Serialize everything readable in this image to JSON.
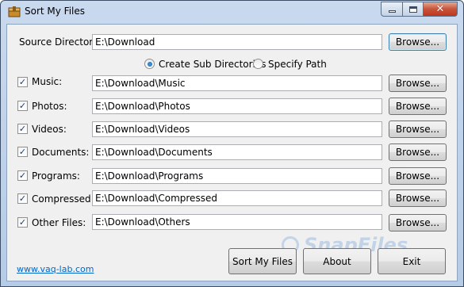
{
  "window": {
    "title": "Sort My Files"
  },
  "source": {
    "label": "Source Directory:",
    "value": "E:\\Download",
    "browse_label": "Browse..."
  },
  "mode": {
    "options": [
      {
        "label": "Create Sub Directories",
        "selected": true
      },
      {
        "label": "Specify Path",
        "selected": false
      }
    ]
  },
  "categories": [
    {
      "label": "Music:",
      "checked": true,
      "path": "E:\\Download\\Music",
      "browse_label": "Browse..."
    },
    {
      "label": "Photos:",
      "checked": true,
      "path": "E:\\Download\\Photos",
      "browse_label": "Browse..."
    },
    {
      "label": "Videos:",
      "checked": true,
      "path": "E:\\Download\\Videos",
      "browse_label": "Browse..."
    },
    {
      "label": "Documents:",
      "checked": true,
      "path": "E:\\Download\\Documents",
      "browse_label": "Browse..."
    },
    {
      "label": "Programs:",
      "checked": true,
      "path": "E:\\Download\\Programs",
      "browse_label": "Browse..."
    },
    {
      "label": "Compressed:",
      "checked": true,
      "path": "E:\\Download\\Compressed",
      "browse_label": "Browse..."
    },
    {
      "label": "Other Files:",
      "checked": true,
      "path": "E:\\Download\\Others",
      "browse_label": "Browse..."
    }
  ],
  "footer": {
    "link": "www.vaq-lab.com",
    "sort_label": "Sort My Files",
    "about_label": "About",
    "exit_label": "Exit"
  },
  "watermark": {
    "text": "SnapFiles"
  },
  "icons": {
    "app": "folder-box-icon",
    "check": "checkmark-icon",
    "close": "close-icon",
    "minimize": "minimize-icon",
    "maximize": "maximize-icon"
  },
  "colors": {
    "accent": "#3c7fb1",
    "link": "#0066cc",
    "close_button": "#c7533a"
  }
}
